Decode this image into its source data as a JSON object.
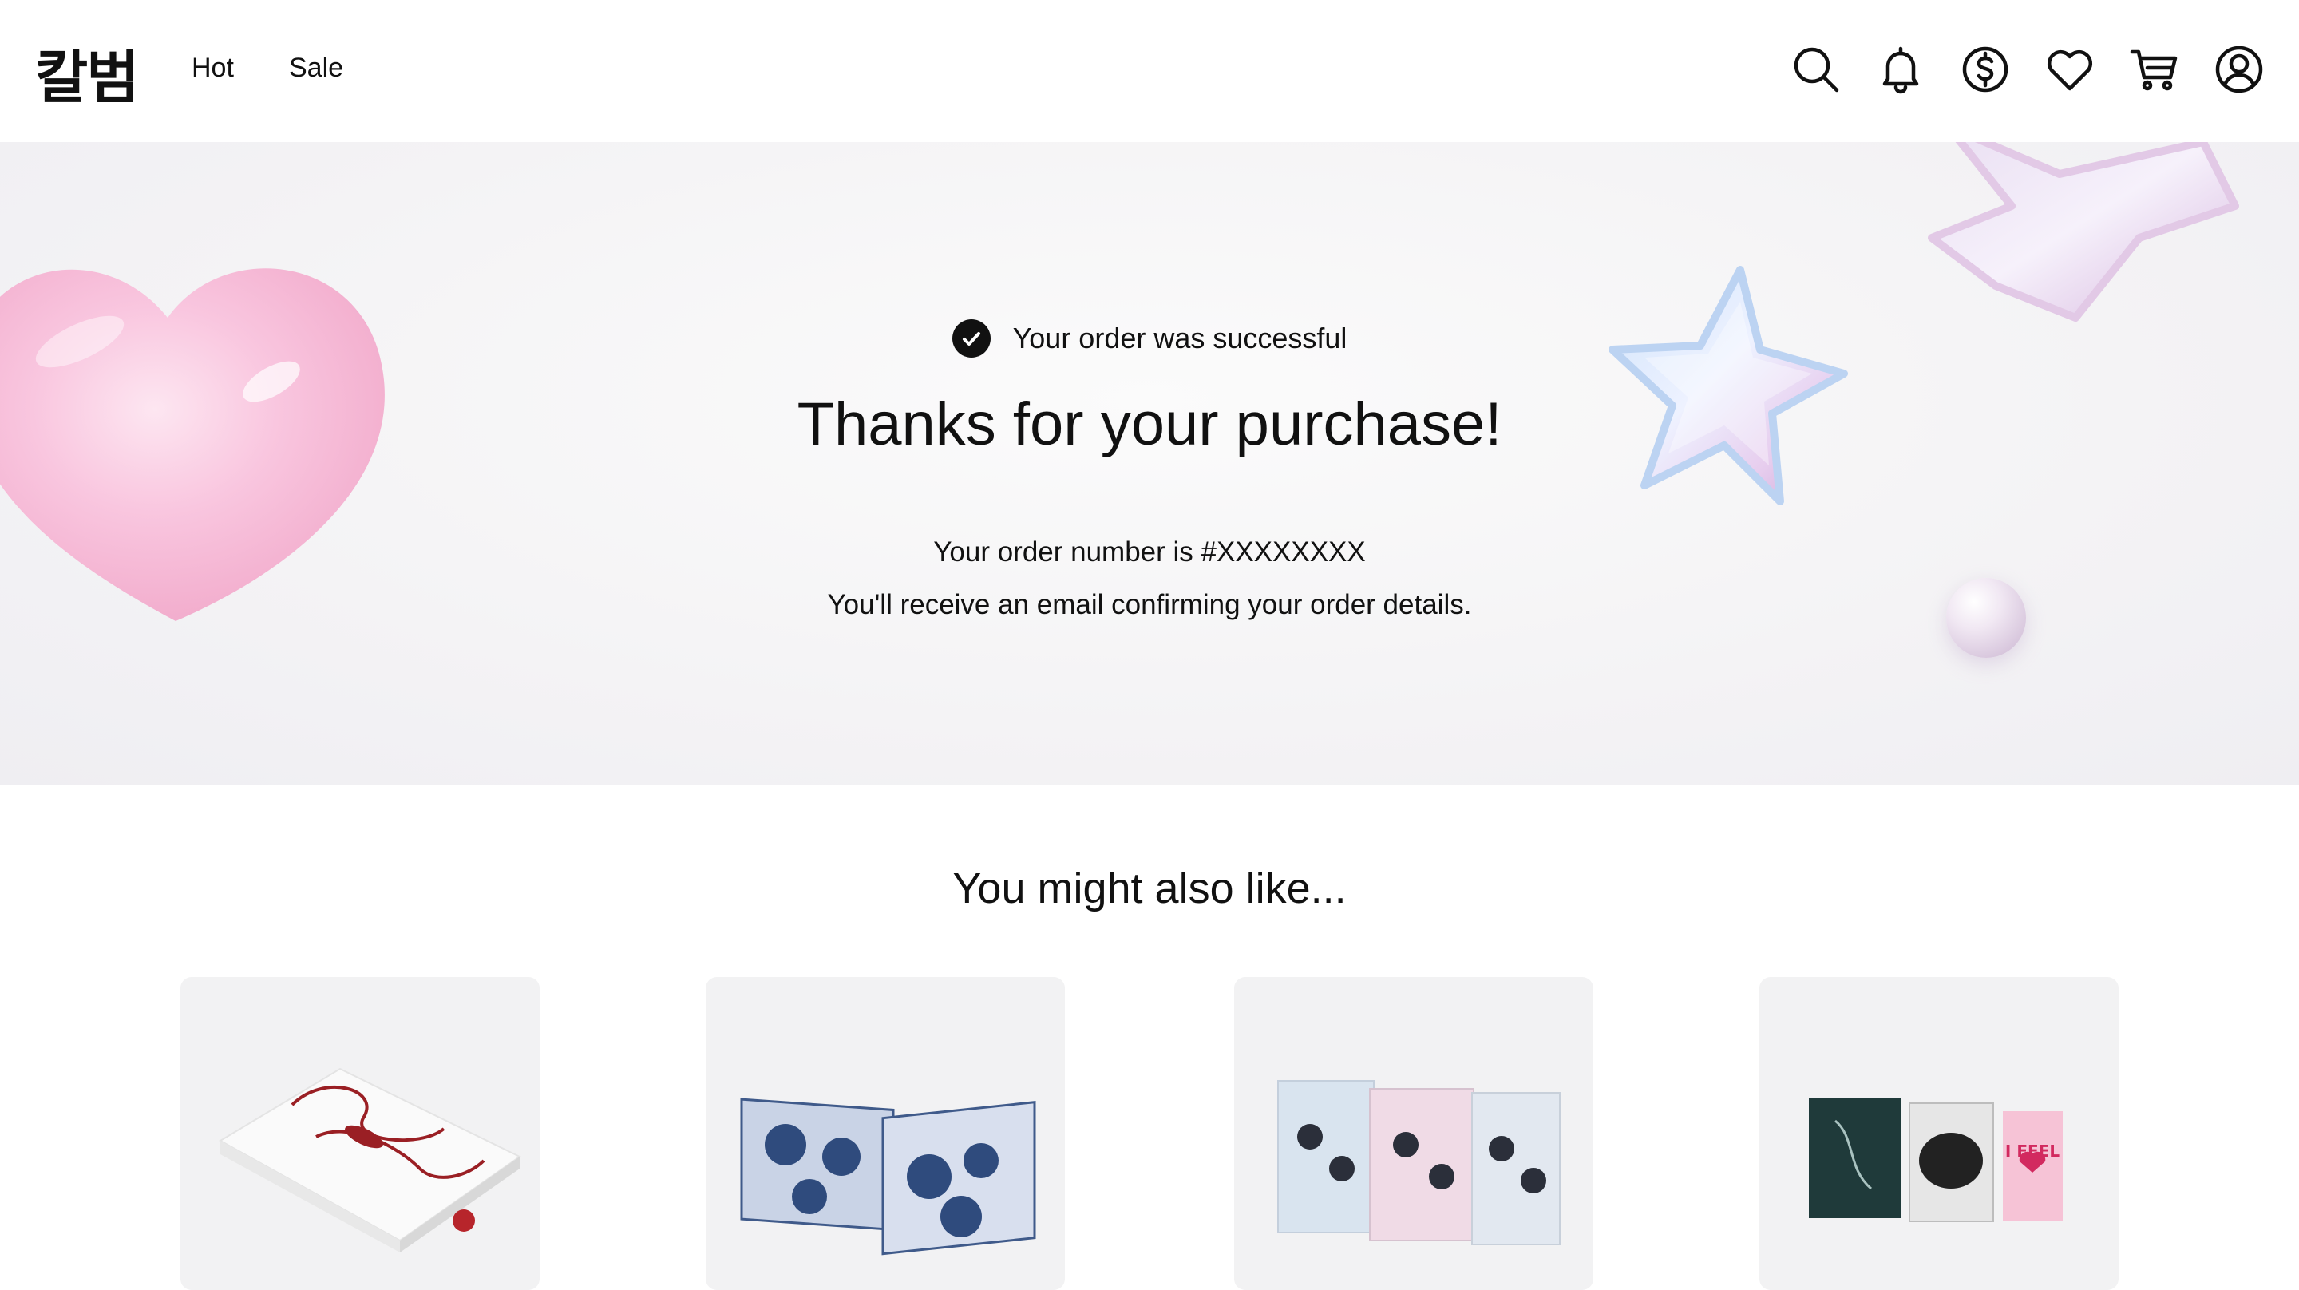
{
  "header": {
    "logo": "칼범",
    "nav": [
      {
        "label": "Hot"
      },
      {
        "label": "Sale"
      }
    ],
    "icons": [
      "search-icon",
      "bell-icon",
      "currency-icon",
      "heart-icon",
      "cart-icon",
      "account-icon"
    ]
  },
  "hero": {
    "success_text": "Your order was successful",
    "title": "Thanks for your purchase!",
    "order_number": "Your order number is #XXXXXXXX",
    "email_note": "You'll receive an email confirming your order details."
  },
  "recommendations": {
    "title": "You might also like...",
    "products": [
      {
        "name": "product-card-1"
      },
      {
        "name": "product-card-2"
      },
      {
        "name": "product-card-3"
      },
      {
        "name": "product-card-4"
      }
    ]
  },
  "colors": {
    "text": "#111111",
    "hero_bg": "#f4f3f5",
    "card_bg": "#f2f2f3",
    "accent_pink": "#f6bcd8"
  }
}
